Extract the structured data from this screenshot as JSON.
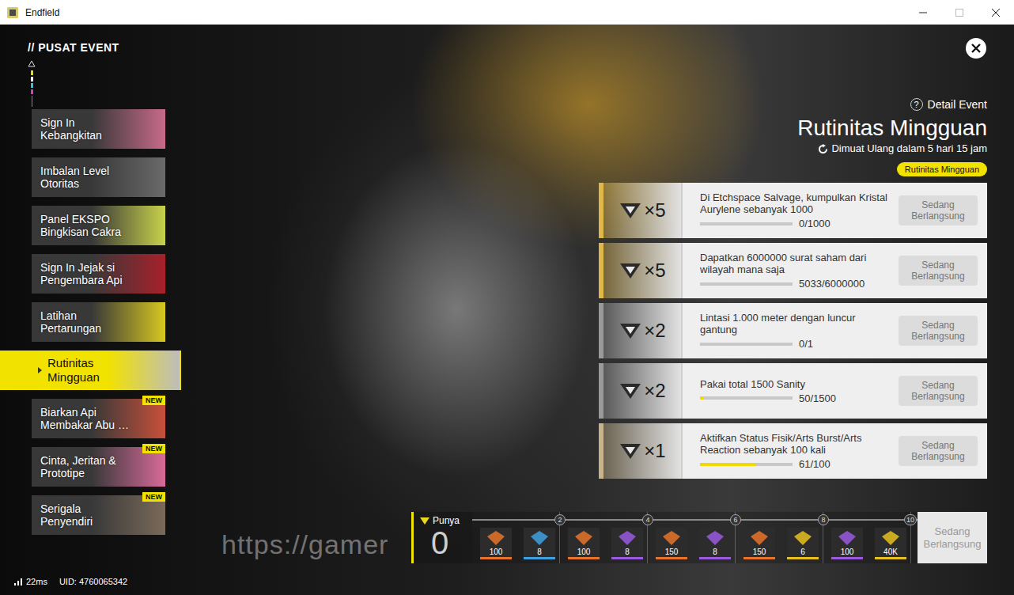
{
  "window": {
    "title": "Endfield"
  },
  "sidebar": {
    "header": "// PUSAT EVENT",
    "items": [
      {
        "lines": [
          "Sign In",
          "Kebangkitan"
        ],
        "selected": false,
        "badge": "",
        "color": "#c86a8a"
      },
      {
        "lines": [
          "Imbalan Level",
          "Otoritas"
        ],
        "selected": false,
        "badge": "",
        "color": "#6a6a6a"
      },
      {
        "lines": [
          "Panel EKSPO",
          "Bingkisan Cakra"
        ],
        "selected": false,
        "badge": "",
        "color": "#c8d24a"
      },
      {
        "lines": [
          "Sign In Jejak si",
          "Pengembara Api"
        ],
        "selected": false,
        "badge": "",
        "color": "#a8202a"
      },
      {
        "lines": [
          "Latihan",
          "Pertarungan"
        ],
        "selected": false,
        "badge": "",
        "color": "#d8c820"
      },
      {
        "lines": [
          "Rutinitas",
          "Mingguan"
        ],
        "selected": true,
        "badge": "",
        "color": "#9a9a9a"
      },
      {
        "lines": [
          "Biarkan Api",
          "Membakar Abu …"
        ],
        "selected": false,
        "badge": "NEW",
        "color": "#c8503a"
      },
      {
        "lines": [
          "Cinta, Jeritan &",
          "Prototipe"
        ],
        "selected": false,
        "badge": "NEW",
        "color": "#d86a9a"
      },
      {
        "lines": [
          "Serigala",
          "Penyendiri"
        ],
        "selected": false,
        "badge": "NEW",
        "color": "#7a6a5a"
      }
    ]
  },
  "status_bar": {
    "ping": "22ms",
    "uid": "UID: 4760065342"
  },
  "watermark": "https://gamer",
  "event": {
    "help_icon": "?",
    "detail": "Detail Event",
    "title": "Rutinitas Mingguan",
    "reload": "Dimuat Ulang dalam 5 hari 15 jam",
    "tag": "Rutinitas Mingguan"
  },
  "tasks": [
    {
      "reward": "×5",
      "text": "Di Etchspace Salvage, kumpulkan Kristal Aurylene sebanyak 1000",
      "progress": "0/1000",
      "level": 0,
      "status": "Sedang Berlangsung",
      "color": "#e0b84a"
    },
    {
      "reward": "×5",
      "text": "Dapatkan 6000000 surat saham dari wilayah mana saja",
      "progress": "5033/6000000",
      "level": 0.0008,
      "status": "Sedang Berlangsung",
      "color": "#e0b84a"
    },
    {
      "reward": "×2",
      "text": "Lintasi 1.000 meter dengan luncur gantung",
      "progress": "0/1",
      "level": 0,
      "status": "Sedang Berlangsung",
      "color": "#9a9a9a"
    },
    {
      "reward": "×2",
      "text": "Pakai total 1500 Sanity",
      "progress": "50/1500",
      "level": 0.033,
      "status": "Sedang Berlangsung",
      "color": "#9a9a9a"
    },
    {
      "reward": "×1",
      "text": "Aktifkan Status Fisik/Arts Burst/Arts Reaction sebanyak 100 kali",
      "progress": "61/100",
      "level": 0.61,
      "status": "Sedang Berlangsung",
      "color": "#c8b48a"
    }
  ],
  "track": {
    "owned_label": "Punya",
    "owned_count": "0",
    "level": 0,
    "milestones": [
      "2",
      "4",
      "6",
      "8",
      "10"
    ],
    "rewards": [
      {
        "amount": "100",
        "color": "#e8742a"
      },
      {
        "amount": "8",
        "color": "#3fa0e0"
      },
      {
        "amount": "100",
        "color": "#e8742a"
      },
      {
        "amount": "8",
        "color": "#9b5be0"
      },
      {
        "amount": "150",
        "color": "#e8742a"
      },
      {
        "amount": "8",
        "color": "#9b5be0"
      },
      {
        "amount": "150",
        "color": "#e8742a"
      },
      {
        "amount": "6",
        "color": "#e8c020"
      },
      {
        "amount": "100",
        "color": "#9b5be0"
      },
      {
        "amount": "40K",
        "color": "#e8c020"
      }
    ],
    "button": "Sedang Berlangsung"
  }
}
